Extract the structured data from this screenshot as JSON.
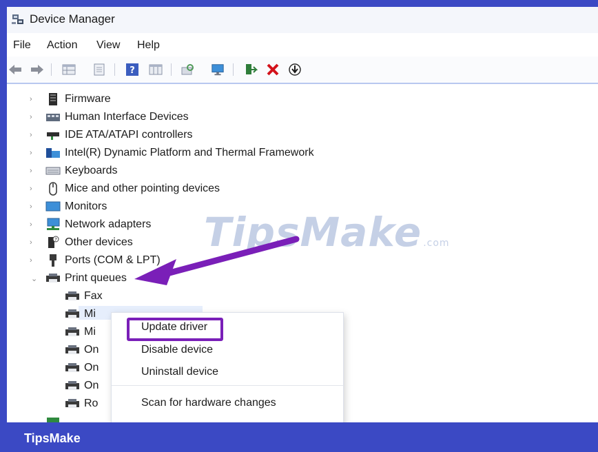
{
  "window": {
    "title": "Device Manager"
  },
  "menu": [
    "File",
    "Action",
    "View",
    "Help"
  ],
  "toolbar": {
    "icons": [
      "back-arrow-icon",
      "forward-arrow-icon",
      "properties-grid-icon",
      "page-icon",
      "help-icon",
      "details-grid-icon",
      "scan-hardware-icon",
      "monitor-icon",
      "enable-device-icon",
      "uninstall-x-icon",
      "download-driver-icon"
    ]
  },
  "tree": {
    "categories": [
      "Firmware",
      "Human Interface Devices",
      "IDE ATA/ATAPI controllers",
      "Intel(R) Dynamic Platform and Thermal Framework",
      "Keyboards",
      "Mice and other pointing devices",
      "Monitors",
      "Network adapters",
      "Other devices",
      "Ports (COM & LPT)",
      "Print queues"
    ],
    "print_queue_children": [
      "Fax",
      "Mi",
      "Mi",
      "On",
      "On",
      "On",
      "Ro"
    ]
  },
  "context_menu": {
    "items": [
      "Update driver",
      "Disable device",
      "Uninstall device",
      "Scan for hardware changes"
    ]
  },
  "watermark": {
    "brand": "TipsMake",
    "suffix": ".com"
  },
  "footer": {
    "brand": "TipsMake"
  },
  "colors": {
    "banner": "#3b49c4",
    "highlight": "#7a1fb8",
    "selection": "#e6eefc"
  }
}
